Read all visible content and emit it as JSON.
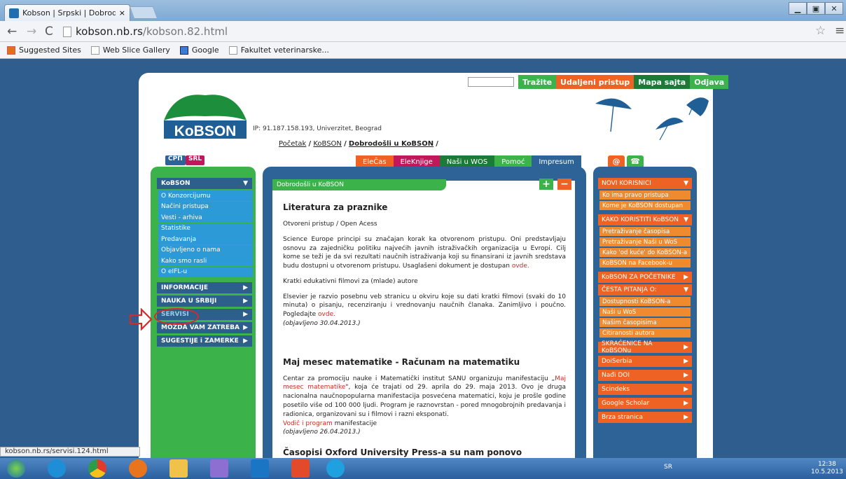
{
  "browser": {
    "tab_title": "Kobson | Srpski | Dobrodo",
    "url_host": "kobson.nb.rs",
    "url_path": "/kobson.82.html",
    "bookmarks": [
      "Suggested Sites",
      "Web Slice Gallery",
      "Google",
      "Fakultet veterinarske..."
    ],
    "status_url": "kobson.nb.rs/servisi.124.html"
  },
  "header": {
    "top_links": [
      {
        "label": "Tražite",
        "color": "#3bb34a"
      },
      {
        "label": "Udaljeni pristup",
        "color": "#ee6324"
      },
      {
        "label": "Mapa sajta",
        "color": "#1b7a36"
      },
      {
        "label": "Odjava",
        "color": "#3bb34a"
      }
    ],
    "logo_text": "KoBSON",
    "ip_text": "IP: 91.187.158.193, Univerzitet, Beograd",
    "breadcrumb": {
      "home": "Početak",
      "sep": "/",
      "section": "KoBSON",
      "current": "Dobrodošli u KoBSON"
    },
    "lang": [
      "СРП",
      "SRL"
    ],
    "mid_nav": [
      {
        "label": "EleČas",
        "color": "#ee6324"
      },
      {
        "label": "EleKnjige",
        "color": "#c0185b"
      },
      {
        "label": "Naši u WOS",
        "color": "#1b7a36"
      },
      {
        "label": "Pomoć",
        "color": "#3bb34a"
      },
      {
        "label": "Impresum",
        "color": "#2d6397"
      }
    ],
    "icons": [
      "at-icon",
      "phone-icon"
    ]
  },
  "left_menu": {
    "section": "KoBSON",
    "items": [
      "O Konzorcijumu",
      "Načini pristupa",
      "Vesti - arhiva",
      "Statistike",
      "Predavanja",
      "Objavljeno o nama",
      "Kako smo rasli",
      "O eIFL-u"
    ],
    "groups": [
      "INFORMACIJE",
      "NAUKA U SRBIJI",
      "SERVISI",
      "MOŽDA VAM ZATREBA",
      "SUGESTIJE i ZAMERKE"
    ]
  },
  "center": {
    "tab": "Dobrodošli u KoBSON",
    "plus": "+",
    "minus": "−",
    "a1_title": "Literatura za praznike",
    "a1_sub": "Otvoreni pristup / Open Acess",
    "a1_p1": "Science Europe principi su značajan korak ka otvorenom pristupu. Oni predstavljaju osnovu za zajedničku politiku najvećih javnih istraživačkih organizacija u Evropi. Cilj kome se teži je da svi rezultati naučnih istraživanja koji su finansirani iz javnih sredstava budu dostupni u otvorenom pristupu. Usaglašeni dokument je dostupan",
    "a1_link1": "ovde.",
    "a1_sub2": "Kratki edukativni filmovi za (mlade) autore",
    "a1_p2": "Elsevier je razvio posebnu veb stranicu u okviru koje su dati kratki filmovi (svaki do 10 minuta) o pisanju, recenziranju i vrednovanju naučnih članaka. Zanimljivo i poučno. Pogledajte",
    "a1_link2": "ovde.",
    "a1_date": "(objavljeno 30.04.2013.)",
    "a2_title": "Maj mesec matematike - Računam na matematiku",
    "a2_p1a": "Centar za promociju nauke i Matematički institut SANU organizuju manifestaciju „",
    "a2_p1link": "Maj mesec matematike",
    "a2_p1b": "\", koja će trajati od 29. aprila do 29. maja 2013. Ovo je druga nacionalna naučnopopularna manifestacija posvećena matematici, koju je prošle godine posetilo više od 100 000 ljudi. Program je raznovrstan - pored mnogobrojnih predavanja i radionica, organizovani su i filmovi i razni eksponati.",
    "a2_link": "Vodič i program",
    "a2_linktail": "manifestacije",
    "a2_date": "(objavljeno 26.04.2013.)",
    "a3_title": "Časopisi Oxford University Press-a su nam ponovo dostupni"
  },
  "right_menu": {
    "h1": "NOVI KORISNICI",
    "s1": [
      "Ko ima pravo pristupa",
      "Kome je KoBSON dostupan"
    ],
    "h2": "KAKO KORISTITI KoBSON",
    "s2": [
      "Pretraživanje časopisa",
      "Pretraživanje Naši u WoS",
      "Kako 'od kuće' do KoBSON-a",
      "KoBSON na Facebook-u"
    ],
    "h3": "KoBSON ZA POČETNIKE",
    "h4": "ČESTA PITANJA O:",
    "s4": [
      "Dostupnosti KoBSON-a",
      "Naši u WoS",
      "Našim časopisima",
      "Citiranosti autora"
    ],
    "h5": [
      "SKRAĆENICE NA KoBSONu",
      "DoiSerbia",
      "Nađi DOI",
      "Scindeks",
      "Google Scholar",
      "Brza stranica"
    ]
  },
  "taskbar": {
    "lang": "SR",
    "time": "12:38",
    "date": "10.5.2013"
  }
}
